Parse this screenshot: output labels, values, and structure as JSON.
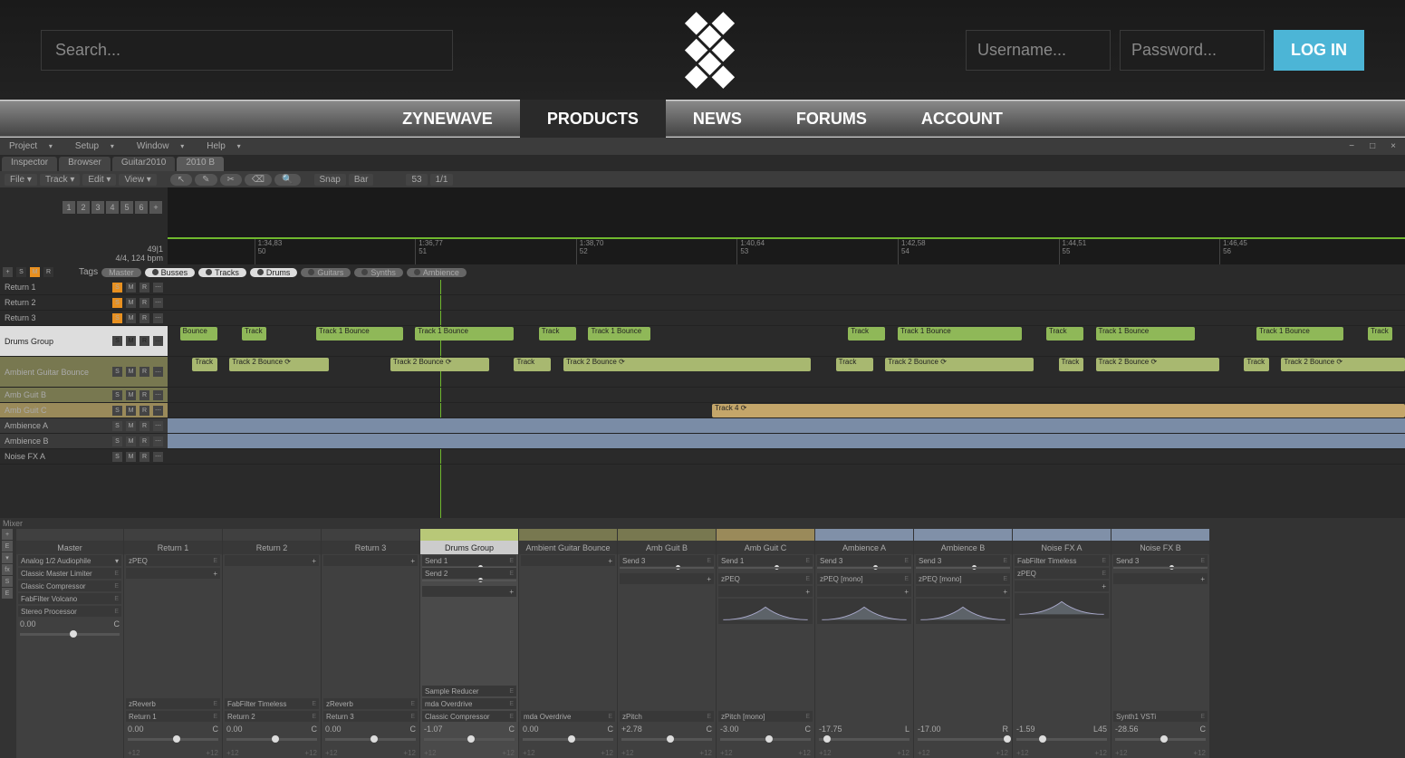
{
  "site": {
    "search_placeholder": "Search...",
    "username_placeholder": "Username...",
    "password_placeholder": "Password...",
    "login_label": "LOG IN",
    "nav": [
      "ZYNEWAVE",
      "PRODUCTS",
      "NEWS",
      "FORUMS",
      "ACCOUNT"
    ],
    "nav_active": 1
  },
  "app": {
    "menus": [
      "Project",
      "Setup",
      "Window",
      "Help"
    ],
    "tabs": [
      "Inspector",
      "Browser",
      "Guitar2010",
      "2010 B"
    ],
    "tab_active": 3,
    "toolbar": {
      "file": "File",
      "track": "Track",
      "edit": "Edit",
      "view": "View",
      "snap": "Snap",
      "bar": "Bar",
      "pos": "53",
      "div": "1/1"
    },
    "overview": {
      "nums": [
        "1",
        "2",
        "3",
        "4",
        "5",
        "6",
        "+"
      ],
      "pos": "49|1",
      "tempo": "4/4, 124 bpm",
      "ruler": [
        {
          "t": "1:34,83",
          "b": "50"
        },
        {
          "t": "1:36,77",
          "b": "51"
        },
        {
          "t": "1:38,70",
          "b": "52"
        },
        {
          "t": "1:40,64",
          "b": "53"
        },
        {
          "t": "1:42,58",
          "b": "54"
        },
        {
          "t": "1:44,51",
          "b": "55"
        },
        {
          "t": "1:46,45",
          "b": "56"
        }
      ]
    },
    "filters": {
      "tags": "Tags",
      "master": "Master",
      "pills": [
        "Busses",
        "Tracks",
        "Drums",
        "Guitars",
        "Synths",
        "Ambience"
      ],
      "active": [
        0,
        1,
        2
      ]
    },
    "tracks": [
      {
        "name": "Return 1",
        "s": true
      },
      {
        "name": "Return 2",
        "s": true
      },
      {
        "name": "Return 3",
        "s": true
      },
      {
        "name": "Drums Group",
        "cls": "drums",
        "h": 34
      },
      {
        "name": "Ambient Guitar Bounce",
        "cls": "amb",
        "h": 34
      },
      {
        "name": "Amb Guit B",
        "cls": "amb"
      },
      {
        "name": "Amb Guit C",
        "cls": "ambc"
      },
      {
        "name": "Ambience A",
        "cls": "blue",
        "blue": true
      },
      {
        "name": "Ambience B",
        "cls": "blue",
        "blue": true
      },
      {
        "name": "Noise FX A"
      }
    ],
    "clips": {
      "track1_bounce": "Track 1 Bounce",
      "track2_bounce": "Track 2 Bounce ⟳",
      "track": "Track",
      "bounce": "Bounce",
      "track4": "Track 4 ⟳"
    },
    "mixer": {
      "label": "Mixer",
      "master": {
        "name": "Master",
        "output": "Analog 1/2 Audiophile",
        "fx": [
          "Classic Master Limiter",
          "Classic Compressor",
          "FabFilter Volcano",
          "Stereo Processor"
        ],
        "db": "0.00",
        "pan": "C"
      },
      "strips": [
        {
          "name": "Return 1",
          "fx": [
            "zPEQ"
          ],
          "bottom": [
            "zReverb",
            "Return 1"
          ],
          "db": "0.00",
          "pan": "C",
          "knob": 50
        },
        {
          "name": "Return 2",
          "bottom": [
            "FabFilter Timeless",
            "Return 2"
          ],
          "db": "0.00",
          "pan": "C",
          "knob": 50
        },
        {
          "name": "Return 3",
          "bottom": [
            "zReverb",
            "Return 3"
          ],
          "db": "0.00",
          "pan": "C",
          "knob": 50
        },
        {
          "name": "Drums Group",
          "top": "t-drums",
          "sel": true,
          "sends": [
            "Send 1",
            "Send 2"
          ],
          "bottom": [
            "Sample Reducer",
            "mda Overdrive",
            "Classic Compressor"
          ],
          "db": "-1.07",
          "pan": "C",
          "knob": 48
        },
        {
          "name": "Ambient Guitar Bounce",
          "top": "t-amb",
          "bottom": [
            "mda Overdrive"
          ],
          "db": "0.00",
          "pan": "C",
          "knob": 50
        },
        {
          "name": "Amb Guit B",
          "top": "t-amb",
          "sends": [
            "Send 3"
          ],
          "bottom": [
            "zPitch"
          ],
          "db": "+2.78",
          "pan": "C",
          "knob": 50
        },
        {
          "name": "Amb Guit C",
          "top": "t-ambc",
          "sends": [
            "Send 1"
          ],
          "fx": [
            "zPEQ"
          ],
          "bottom": [
            "zPitch [mono]"
          ],
          "db": "-3.00",
          "pan": "C",
          "knob": 50,
          "eq": true
        },
        {
          "name": "Ambience A",
          "top": "t-blue",
          "sends": [
            "Send 3"
          ],
          "fx": [
            "zPEQ [mono]"
          ],
          "db": "-17.75",
          "pan": "L",
          "knob": 5,
          "eq": true
        },
        {
          "name": "Ambience B",
          "top": "t-blue",
          "sends": [
            "Send 3"
          ],
          "fx": [
            "zPEQ [mono]"
          ],
          "db": "-17.00",
          "pan": "R",
          "knob": 95,
          "eq": true
        },
        {
          "name": "Noise FX A",
          "top": "t-blue",
          "fx": [
            "FabFilter Timeless",
            "zPEQ"
          ],
          "db": "-1.59",
          "pan": "L45",
          "knob": 25,
          "eq": true
        },
        {
          "name": "Noise FX B",
          "top": "t-blue",
          "sends": [
            "Send 3"
          ],
          "bottom": [
            "Synth1 VSTi"
          ],
          "db": "-28.56",
          "pan": "C",
          "knob": 50
        }
      ],
      "db_scale": [
        "+12",
        "+12"
      ]
    }
  }
}
